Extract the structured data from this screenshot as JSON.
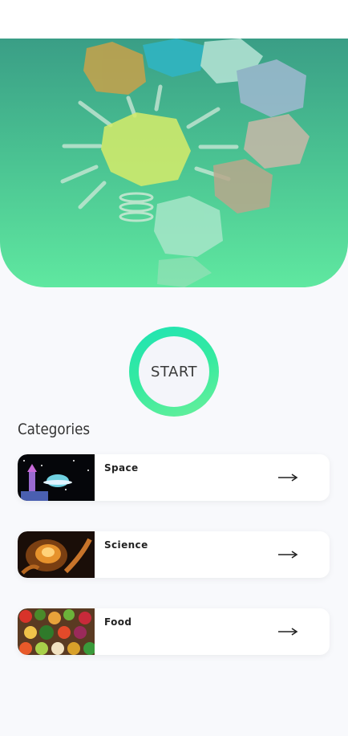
{
  "hero": {
    "image_name": "crumpled-paper-lightbulb-image",
    "colors": {
      "top": "#3a9e86",
      "bottom": "#5fe8a0"
    }
  },
  "start": {
    "label": "START"
  },
  "categories": {
    "title": "Categories",
    "items": [
      {
        "label": "Space",
        "thumb": "space-thumbnail"
      },
      {
        "label": "Science",
        "thumb": "science-thumbnail"
      },
      {
        "label": "Food",
        "thumb": "food-thumbnail"
      }
    ]
  },
  "icons": {
    "arrow": "arrow-right-icon"
  }
}
